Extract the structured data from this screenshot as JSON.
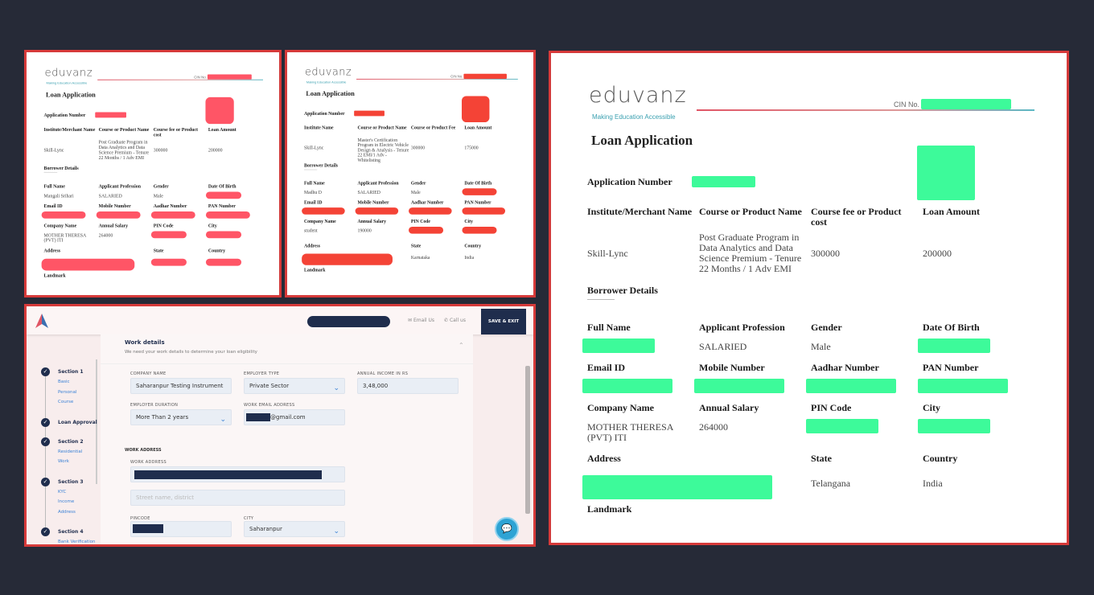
{
  "documents": [
    {
      "logo_text": "eduvanz",
      "tagline": "Making Education Accessible",
      "cin_label": "CIN No.",
      "title": "Loan Application",
      "app_number_label": "Application Number",
      "redact_color": "#ff5566",
      "headers": [
        "Institute/Merchant Name",
        "Course or Product Name",
        "Course fee or Product cost",
        "Loan Amount"
      ],
      "course_values": [
        "Skill-Lync",
        "Post Graduate Program in Data Analytics and Data Science Premium - Tenure 22 Months / 1 Adv EMI",
        "300000",
        "200000"
      ],
      "borrower_title": "Borrower Details",
      "rows": [
        {
          "labels": [
            "Full Name",
            "Applicant Profession",
            "Gender",
            "Date Of Birth"
          ],
          "values": [
            "Mangali Srihari",
            "SALARIED",
            "Male",
            ""
          ]
        },
        {
          "labels": [
            "Email ID",
            "Mobile Number",
            "Aadhar Number",
            "PAN Number"
          ],
          "values": [
            "",
            "",
            "",
            ""
          ]
        },
        {
          "labels": [
            "Company Name",
            "Annual Salary",
            "PIN Code",
            "City"
          ],
          "values": [
            "MOTHER THERESA (PVT) ITI",
            "264000",
            "",
            ""
          ]
        },
        {
          "labels": [
            "Address",
            "",
            "State",
            "Country"
          ],
          "values": [
            "",
            "",
            "",
            ""
          ]
        }
      ],
      "landmark_label": "Landmark"
    },
    {
      "logo_text": "eduvanz",
      "tagline": "Making Education Accessible",
      "cin_label": "CIN No.",
      "title": "Loan Application",
      "app_number_label": "Application Number",
      "redact_color": "#f44336",
      "headers": [
        "Institute Name",
        "Course or Product Name",
        "Course or Product Fee",
        "Loan Amount"
      ],
      "course_values": [
        "Skill-Lync",
        "Master's Certification Program in Electric Vehicle Design & Analysis - Tenure 22 EMI/1 Adv - Whitelisting",
        "300000",
        "175000"
      ],
      "borrower_title": "Borrower Details",
      "rows": [
        {
          "labels": [
            "Full Name",
            "Applicant Profession",
            "Gender",
            "Date Of Birth"
          ],
          "values": [
            "Madhu D",
            "SALARIED",
            "Male",
            ""
          ]
        },
        {
          "labels": [
            "Email ID",
            "Mobile Number",
            "Aadhar Number",
            "PAN Number"
          ],
          "values": [
            "",
            "",
            "",
            ""
          ]
        },
        {
          "labels": [
            "Company Name",
            "Annual Salary",
            "PIN Code",
            "City"
          ],
          "values": [
            "student",
            "190000",
            "",
            ""
          ]
        },
        {
          "labels": [
            "Address",
            "",
            "State",
            "Country"
          ],
          "values": [
            "",
            "",
            "Karnataka",
            "India"
          ]
        }
      ],
      "landmark_label": "Landmark"
    },
    {
      "logo_text": "eduvanz",
      "tagline": "Making Education Accessible",
      "cin_label": "CIN No.",
      "title": "Loan Application",
      "app_number_label": "Application Number",
      "redact_color": "#3dfa9a",
      "headers": [
        "Institute/Merchant Name",
        "Course or Product Name",
        "Course fee or Product cost",
        "Loan Amount"
      ],
      "course_values": [
        "Skill-Lync",
        "Post Graduate Program in Data Analytics and Data Science Premium - Tenure 22 Months / 1 Adv EMI",
        "300000",
        "200000"
      ],
      "borrower_title": "Borrower Details",
      "rows": [
        {
          "labels": [
            "Full Name",
            "Applicant Profession",
            "Gender",
            "Date Of Birth"
          ],
          "values": [
            "",
            "SALARIED",
            "Male",
            ""
          ]
        },
        {
          "labels": [
            "Email ID",
            "Mobile Number",
            "Aadhar Number",
            "PAN Number"
          ],
          "values": [
            "",
            "",
            "",
            ""
          ]
        },
        {
          "labels": [
            "Company Name",
            "Annual Salary",
            "PIN Code",
            "City"
          ],
          "values": [
            "MOTHER THERESA (PVT) ITI",
            "264000",
            "",
            ""
          ]
        },
        {
          "labels": [
            "Address",
            "",
            "State",
            "Country"
          ],
          "values": [
            "",
            "",
            "Telangana",
            "India"
          ]
        }
      ],
      "landmark_label": "Landmark"
    }
  ],
  "app": {
    "header": {
      "email_label": "Email Us",
      "call_label": "Call us",
      "save_exit_label": "SAVE & EXIT"
    },
    "sidebar": {
      "steps": [
        {
          "title": "Section 1",
          "subs": [
            "Basic",
            "Personal",
            "Course"
          ]
        },
        {
          "title": "Loan Approval",
          "subs": []
        },
        {
          "title": "Section 2",
          "subs": [
            "Residential",
            "Work"
          ]
        },
        {
          "title": "Section 3",
          "subs": [
            "KYC",
            "Income",
            "Address"
          ]
        },
        {
          "title": "Section 4",
          "subs": [
            "Bank Verification"
          ]
        }
      ]
    },
    "work": {
      "title": "Work details",
      "subtitle": "We need your work details to determine your loan eligibility",
      "company_name_label": "COMPANY NAME",
      "company_name_value": "Saharanpur Testing Instrument",
      "employer_type_label": "EMPLOYER TYPE",
      "employer_type_value": "Private Sector",
      "annual_income_label": "ANNUAL INCOME IN RS",
      "annual_income_value": "3,48,000",
      "employer_duration_label": "EMPLOYER DURATION",
      "employer_duration_value": "More Than 2 years",
      "work_email_label": "WORK EMAIL ADDRESS",
      "work_email_value": "@gmail.com",
      "work_address_section": "WORK ADDRESS",
      "work_address_label": "WORK ADDRESS",
      "street_placeholder": "Street name, district",
      "pincode_label": "PINCODE",
      "city_label": "CITY",
      "city_value": "Saharanpur"
    },
    "colors": {
      "navy": "#1f2d4d",
      "accent": "#3b82d6",
      "chat": "#2ea3d4"
    }
  }
}
